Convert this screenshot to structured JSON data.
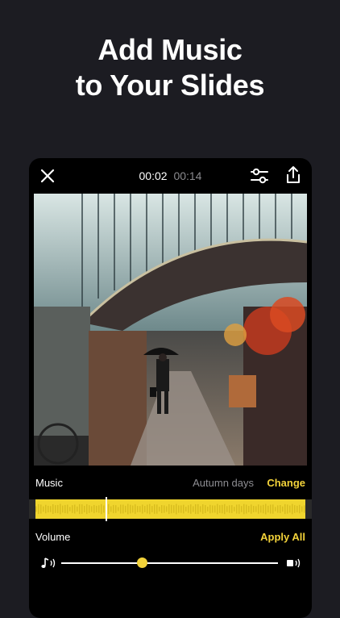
{
  "headline": {
    "line1": "Add Music",
    "line2": "to Your Slides"
  },
  "player": {
    "current_time": "00:02",
    "total_time": "00:14"
  },
  "icons": {
    "close": "close-icon",
    "adjust": "sliders-icon",
    "share": "share-icon",
    "music_note": "music-note-icon",
    "speaker": "speaker-icon"
  },
  "music": {
    "label": "Music",
    "track": "Autumn days",
    "change": "Change",
    "playhead_fraction": 0.26
  },
  "volume": {
    "label": "Volume",
    "apply_all": "Apply All",
    "level": 0.37
  },
  "colors": {
    "accent": "#f2d23a",
    "background": "#1c1c22",
    "panel": "#000000"
  }
}
